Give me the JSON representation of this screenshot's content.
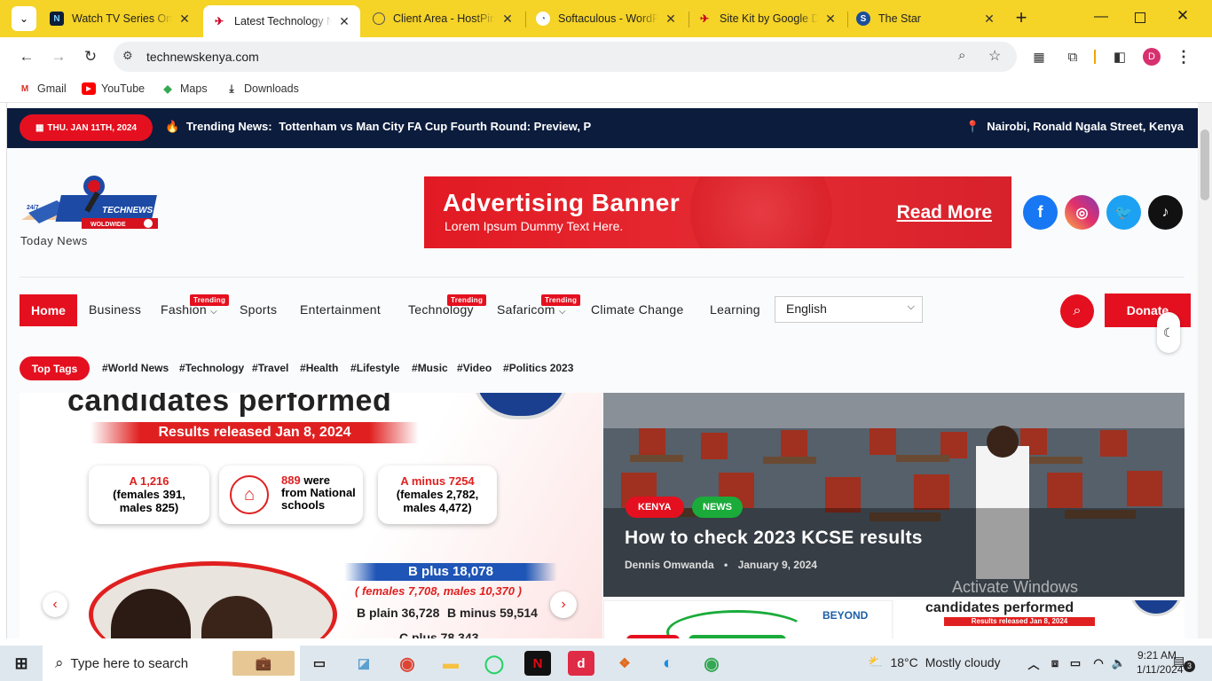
{
  "browser": {
    "tabs": [
      {
        "title": "Watch TV Series Online",
        "active": false
      },
      {
        "title": "Latest Technology News",
        "active": true
      },
      {
        "title": "Client Area - HostPinnacle",
        "active": false
      },
      {
        "title": "Softaculous - WordPress",
        "active": false
      },
      {
        "title": "Site Kit by Google Dashboard",
        "active": false
      },
      {
        "title": "The Star",
        "active": false
      }
    ],
    "url": "technewskenya.com",
    "profile_initial": "D",
    "bookmarks": [
      "Gmail",
      "YouTube",
      "Maps",
      "Downloads"
    ]
  },
  "site": {
    "date": "THU. JAN 11TH, 2024",
    "trending_label": "Trending News:",
    "trending_text": "Tottenham vs Man City FA Cup Fourth Round: Preview, P",
    "location": "Nairobi, Ronald Ngala Street, Kenya",
    "logo_top": "24/7",
    "logo_main": "TECHNEWS",
    "logo_sub": "WOLDWIDE",
    "logo_tagline": "Today News",
    "ad_title": "Advertising Banner",
    "ad_subtitle": "Lorem Ipsum Dummy Text Here.",
    "ad_cta": "Read More",
    "nav": {
      "home": "Home",
      "items": [
        "Business",
        "Fashion",
        "Sports",
        "Entertainment",
        "Technology",
        "Safaricom",
        "Climate Change",
        "Learning"
      ],
      "trending_badge": "Trending",
      "language": "English",
      "donate": "Donate"
    },
    "top_tags_label": "Top Tags",
    "tags": [
      "World News",
      "Technology",
      "Travel",
      "Health",
      "Lifestyle",
      "Music",
      "Video",
      "Politics 2023"
    ],
    "hero": {
      "heading": "candidates performed",
      "released": "Results released Jan 8, 2024",
      "stat1": "A 1,216",
      "stat1_sub1": "(females 391,",
      "stat1_sub2": "males 825)",
      "stat2_a": "889",
      "stat2_b": "were",
      "stat2_c": "from National",
      "stat2_d": "schools",
      "stat3": "A minus 7254",
      "stat3_sub1": "(females 2,782,",
      "stat3_sub2": "males 4,472)",
      "bplus": "B plus 18,078",
      "bplus_sub": "( females 7,708, males 10,370 )",
      "bplain": "B plain 36,728",
      "bminus": "B minus 59,514",
      "cplus": "C plus 78,343"
    },
    "featured": {
      "cat1": "KENYA",
      "cat2": "NEWS",
      "title": "How to check 2023 KCSE results",
      "author": "Dennis Omwanda",
      "date": "January 9, 2024"
    },
    "small2_heading": "candidates performed",
    "small2_released": "Results released Jan 8, 2024",
    "small1_brand": "BEYOND",
    "watermark": "Activate Windows"
  },
  "taskbar": {
    "search_placeholder": "Type here to search",
    "temperature": "18°C",
    "weather": "Mostly cloudy",
    "time": "9:21 AM",
    "date": "1/11/2024",
    "notifications": "3"
  }
}
